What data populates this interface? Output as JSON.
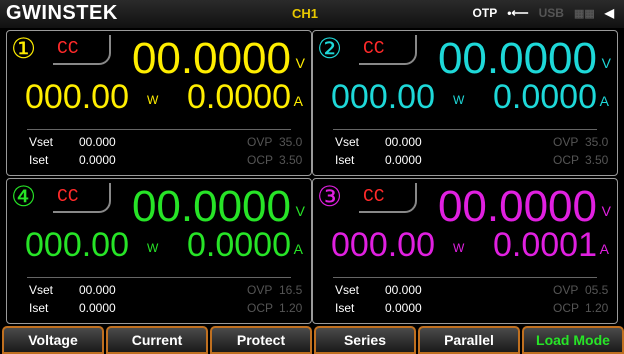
{
  "topbar": {
    "logo": "GWINSTEK",
    "channel": "CH1",
    "otp": "OTP",
    "usb_label": "USB",
    "icons": [
      "usb-plug-icon",
      "memory-icon",
      "speaker-icon"
    ]
  },
  "channels": [
    {
      "num": "①",
      "mode": "CC",
      "voltage": "00.0000",
      "v_unit": "V",
      "power": "000.00",
      "w_unit": "W",
      "current": "0.0000",
      "a_unit": "A",
      "vset_label": "Vset",
      "vset": "00.000",
      "iset_label": "Iset",
      "iset": "0.0000",
      "ovp_label": "OVP",
      "ovp": "35.0",
      "ocp_label": "OCP",
      "ocp": "3.50",
      "color": "#ffee00"
    },
    {
      "num": "②",
      "mode": "CC",
      "voltage": "00.0000",
      "v_unit": "V",
      "power": "000.00",
      "w_unit": "W",
      "current": "0.0000",
      "a_unit": "A",
      "vset_label": "Vset",
      "vset": "00.000",
      "iset_label": "Iset",
      "iset": "0.0000",
      "ovp_label": "OVP",
      "ovp": "35.0",
      "ocp_label": "OCP",
      "ocp": "3.50",
      "color": "#1ed8d8"
    },
    {
      "num": "④",
      "mode": "CC",
      "voltage": "00.0000",
      "v_unit": "V",
      "power": "000.00",
      "w_unit": "W",
      "current": "0.0000",
      "a_unit": "A",
      "vset_label": "Vset",
      "vset": "00.000",
      "iset_label": "Iset",
      "iset": "0.0000",
      "ovp_label": "OVP",
      "ovp": "16.5",
      "ocp_label": "OCP",
      "ocp": "1.20",
      "color": "#27e427"
    },
    {
      "num": "③",
      "mode": "CC",
      "voltage": "00.0000",
      "v_unit": "V",
      "power": "000.00",
      "w_unit": "W",
      "current": "0.0001",
      "a_unit": "A",
      "vset_label": "Vset",
      "vset": "00.000",
      "iset_label": "Iset",
      "iset": "0.0000",
      "ovp_label": "OVP",
      "ovp": "05.5",
      "ocp_label": "OCP",
      "ocp": "1.20",
      "color": "#e020e0"
    }
  ],
  "softkeys": [
    "Voltage",
    "Current",
    "Protect",
    "Series",
    "Parallel",
    "Load Mode"
  ],
  "colors": {
    "mode": "#ff2a2a",
    "softkey_border": "#c07020",
    "active_key": "#27e427",
    "channel_label": "#e8c800"
  }
}
